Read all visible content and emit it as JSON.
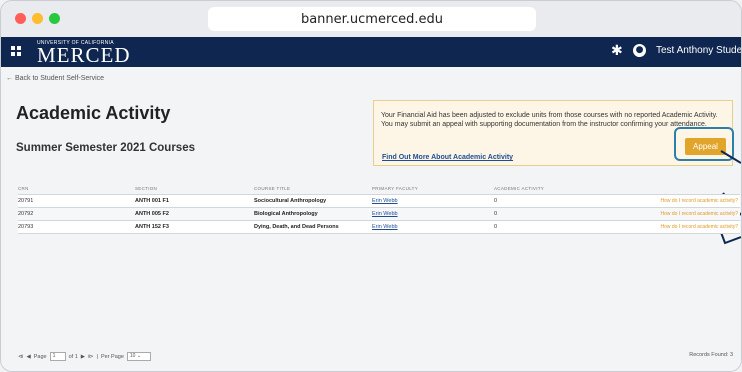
{
  "browser": {
    "url": "banner.ucmerced.edu"
  },
  "nav": {
    "logo_top": "UNIVERSITY OF CALIFORNIA",
    "logo_main": "MERCED",
    "settings_icon": "gear-icon",
    "user_icon": "user-icon",
    "user_name": "Test Anthony Student"
  },
  "page": {
    "back_link": "← Back to Student Self-Service",
    "title": "Academic Activity",
    "subtitle": "Summer Semester 2021 Courses"
  },
  "notice": {
    "text": "Your Financial Aid has been adjusted to exclude units from those courses with no reported Academic Activity. You may submit an appeal with supporting documentation from the instructor confirming your attendance.",
    "link": "Find Out More About Academic Activity",
    "appeal_label": "Appeal"
  },
  "table": {
    "headers": [
      "CRN",
      "SECTION",
      "COURSE TITLE",
      "PRIMARY FACULTY",
      "ACADEMIC ACTIVITY",
      ""
    ],
    "rows": [
      {
        "crn": "20791",
        "section": "ANTH 001 F1",
        "title": "Sociocultural Anthropology",
        "faculty": "Erin Webb",
        "activity": "0",
        "help": "How do I record academic activity?"
      },
      {
        "crn": "20792",
        "section": "ANTH 005 F2",
        "title": "Biological Anthropology",
        "faculty": "Erin Webb",
        "activity": "0",
        "help": "How do I record academic activity?"
      },
      {
        "crn": "20793",
        "section": "ANTH 152 F3",
        "title": "Dying, Death, and Dead Persons",
        "faculty": "Erin Webb",
        "activity": "0",
        "help": "How do I record academic activity?"
      }
    ]
  },
  "pager": {
    "first": "⧏",
    "prev": "◀",
    "page_label": "Page",
    "page_value": "1",
    "of_label": "of 1",
    "next": "▶",
    "last": "⧐",
    "per_page_label": "Per Page",
    "per_page_value": "10",
    "records": "Records Found: 3"
  }
}
